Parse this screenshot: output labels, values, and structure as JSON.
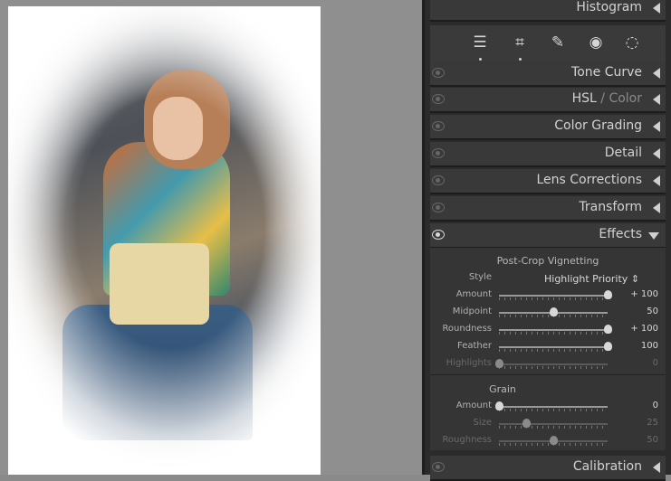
{
  "panel": {
    "histogram": "Histogram",
    "sections": {
      "tone_curve": "Tone Curve",
      "hsl": "HSL",
      "hsl_sep": " / ",
      "color": "Color",
      "color_grading": "Color Grading",
      "detail": "Detail",
      "lens_corrections": "Lens Corrections",
      "transform": "Transform",
      "effects": "Effects",
      "calibration": "Calibration"
    },
    "tools": [
      {
        "icon": "sliders-icon",
        "glyph": "☰"
      },
      {
        "icon": "crop-icon",
        "glyph": "⌗"
      },
      {
        "icon": "healing-bandage-icon",
        "glyph": "✎"
      },
      {
        "icon": "red-eye-icon",
        "glyph": "◉"
      },
      {
        "icon": "masking-icon",
        "glyph": "◌"
      }
    ]
  },
  "effects": {
    "vignette_title": "Post-Crop Vignetting",
    "style_label": "Style",
    "style_value": "Highlight Priority",
    "sliders": [
      {
        "label": "Amount",
        "value": "+ 100",
        "pos": 1.0
      },
      {
        "label": "Midpoint",
        "value": "50",
        "pos": 0.5
      },
      {
        "label": "Roundness",
        "value": "+ 100",
        "pos": 1.0
      },
      {
        "label": "Feather",
        "value": "100",
        "pos": 1.0
      },
      {
        "label": "Highlights",
        "value": "0",
        "pos": 0.0
      }
    ],
    "grain_title": "Grain",
    "grain_sliders": [
      {
        "label": "Amount",
        "value": "0",
        "pos": 0.0
      },
      {
        "label": "Size",
        "value": "25",
        "pos": 0.25
      },
      {
        "label": "Roughness",
        "value": "50",
        "pos": 0.5
      }
    ]
  }
}
